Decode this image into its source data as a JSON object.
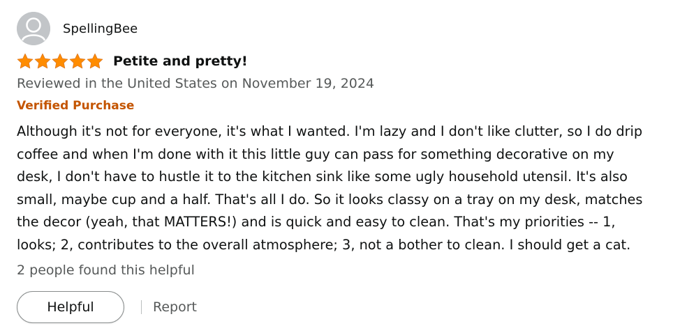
{
  "review": {
    "username": "SpellingBee",
    "rating": 5,
    "max_rating": 5,
    "star_color": "#ff8c00",
    "title": "Petite and pretty!",
    "date_line": "Reviewed in the United States on November 19, 2024",
    "verified_label": "Verified Purchase",
    "verified_color": "#c45500",
    "body_lines": [
      "Although it's not for everyone, it's what I wanted. I'm lazy and I don't like clutter, so I do drip",
      "coffee and when I'm done with it this little guy can pass for something decorative on my",
      "desk, I don't have to hustle it to the kitchen sink like some ugly household utensil. It's also",
      "small, maybe cup and a half. That's all I do. So it looks classy on a tray on my desk, matches",
      "the decor (yeah, that MATTERS!) and is quick and easy to clean. That's my priorities -- 1,",
      "looks; 2, contributes to the overall atmosphere; 3, not a bother to clean. I should get a cat."
    ],
    "helpful_count_text": "2 people found this helpful",
    "helpful_button_label": "Helpful",
    "report_label": "Report"
  },
  "icons": {
    "avatar": "user-avatar-icon",
    "star": "star-icon"
  }
}
